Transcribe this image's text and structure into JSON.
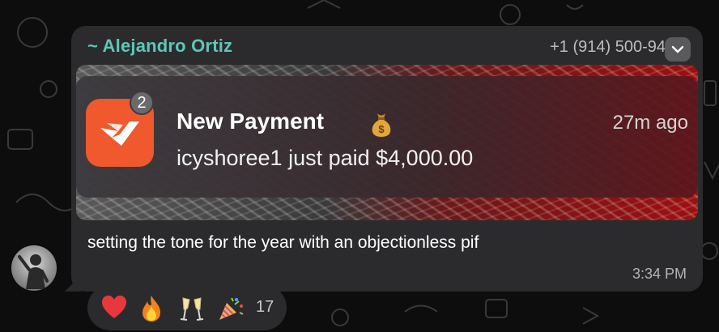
{
  "message": {
    "sender_name": "~ Alejandro Ortiz",
    "phone": "+1 (914) 500-94",
    "caption": "setting the tone for the year with an objectionless pif",
    "time": "3:34 PM"
  },
  "notification": {
    "badge_count": "2",
    "title": "New Payment",
    "emoji": "money-bag-icon",
    "time_ago": "27m ago",
    "body": "icyshoree1 just paid $4,000.00"
  },
  "reactions": {
    "items": [
      "heart",
      "fire",
      "champagne-glasses",
      "party-popper"
    ],
    "count": "17"
  },
  "colors": {
    "sender": "#5fc7b6",
    "bubble": "#2b2b2d",
    "app_icon": "#f0582d"
  }
}
